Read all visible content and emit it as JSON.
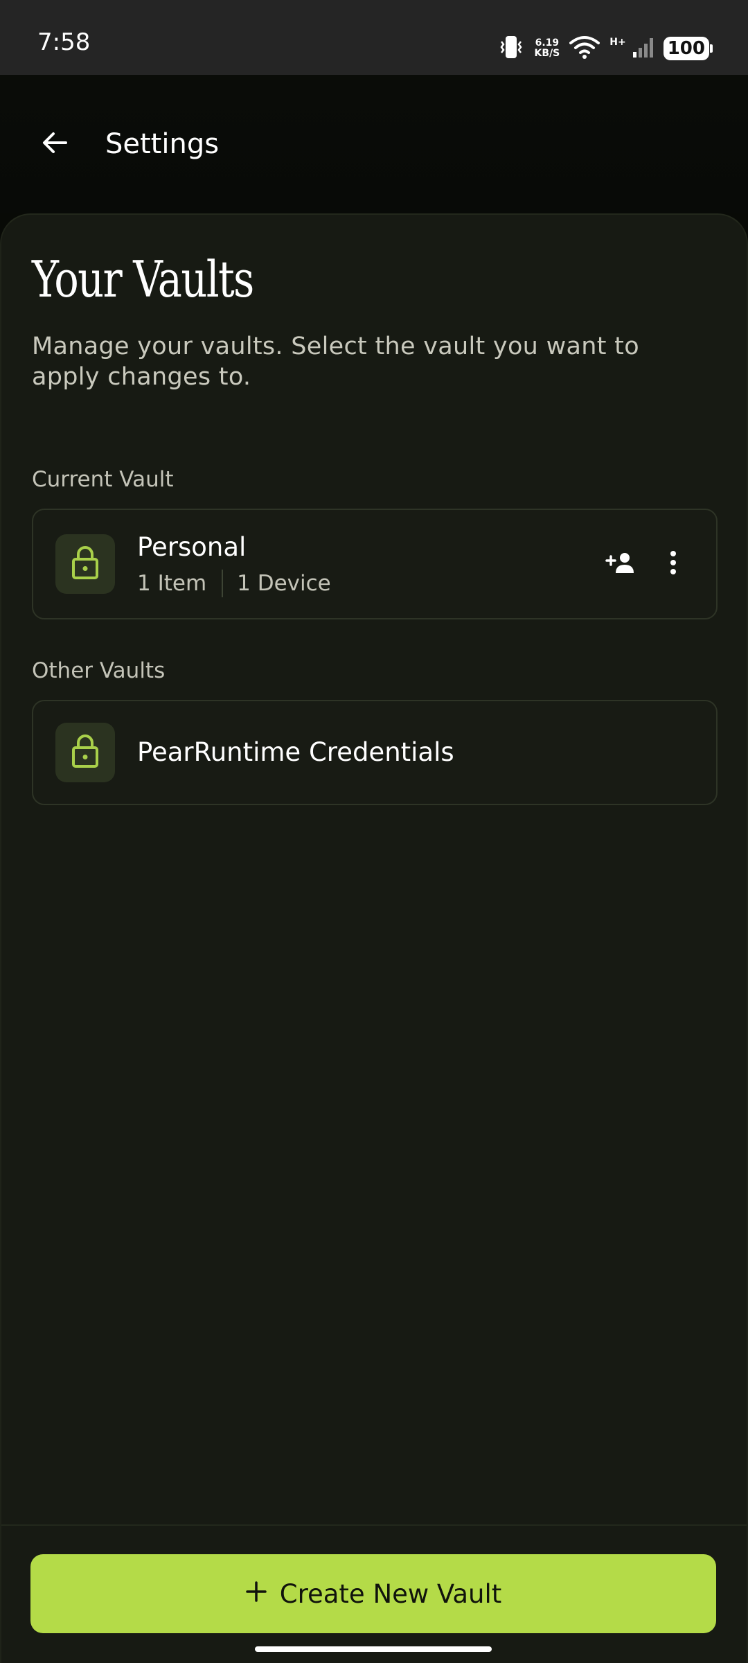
{
  "status_bar": {
    "time": "7:58",
    "net_speed_value": "6.19",
    "net_speed_unit": "KB/S",
    "network_type": "H+",
    "battery": "100"
  },
  "top_bar": {
    "title": "Settings",
    "back_icon": "arrow-left-icon"
  },
  "main": {
    "heading": "Your Vaults",
    "description": "Manage your vaults. Select the vault you want to apply changes to.",
    "current_section_label": "Current Vault",
    "current_vault": {
      "name": "Personal",
      "items": "1 Item",
      "devices": "1 Device",
      "icon": "lock-icon",
      "actions": [
        "add-person-icon",
        "more-vertical-icon"
      ]
    },
    "other_section_label": "Other Vaults",
    "other_vaults": [
      {
        "name": "PearRuntime Credentials",
        "icon": "lock-icon"
      }
    ]
  },
  "footer": {
    "create_button_label": "Create New Vault",
    "create_button_icon": "plus-icon"
  },
  "colors": {
    "accent": "#b4db48",
    "lock_icon": "#a9d04a",
    "background": "#171a13",
    "card_border": "#2e3426"
  }
}
